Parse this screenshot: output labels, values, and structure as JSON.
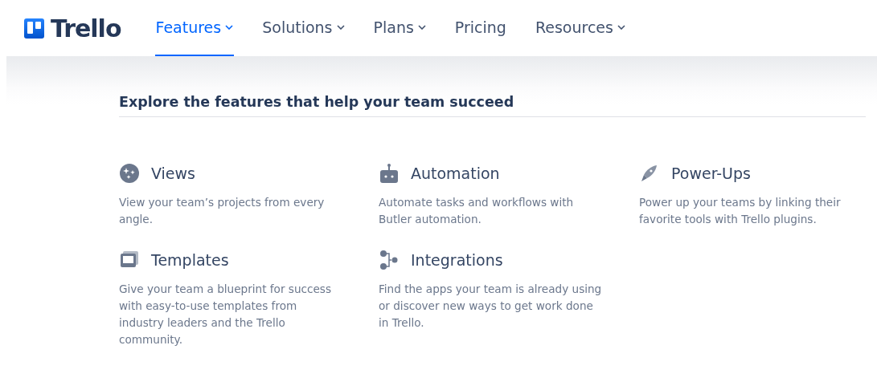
{
  "logo": {
    "text": "Trello"
  },
  "nav": [
    {
      "label": "Features",
      "dropdown": true,
      "selected": true
    },
    {
      "label": "Solutions",
      "dropdown": true,
      "selected": false
    },
    {
      "label": "Plans",
      "dropdown": true,
      "selected": false
    },
    {
      "label": "Pricing",
      "dropdown": false,
      "selected": false
    },
    {
      "label": "Resources",
      "dropdown": true,
      "selected": false
    }
  ],
  "panel": {
    "heading": "Explore the features that help your team succeed",
    "features": [
      {
        "title": "Views",
        "description": "View your team’s projects from every angle."
      },
      {
        "title": "Automation",
        "description": "Automate tasks and workflows with Butler automation."
      },
      {
        "title": "Power-Ups",
        "description": "Power up your teams by linking their favorite tools with Trello plugins."
      },
      {
        "title": "Templates",
        "description": "Give your team a blueprint for success with easy-to-use templates from industry leaders and the Trello community."
      },
      {
        "title": "Integrations",
        "description": "Find the apps your team is already using or discover new ways to get work done in Trello."
      }
    ]
  }
}
